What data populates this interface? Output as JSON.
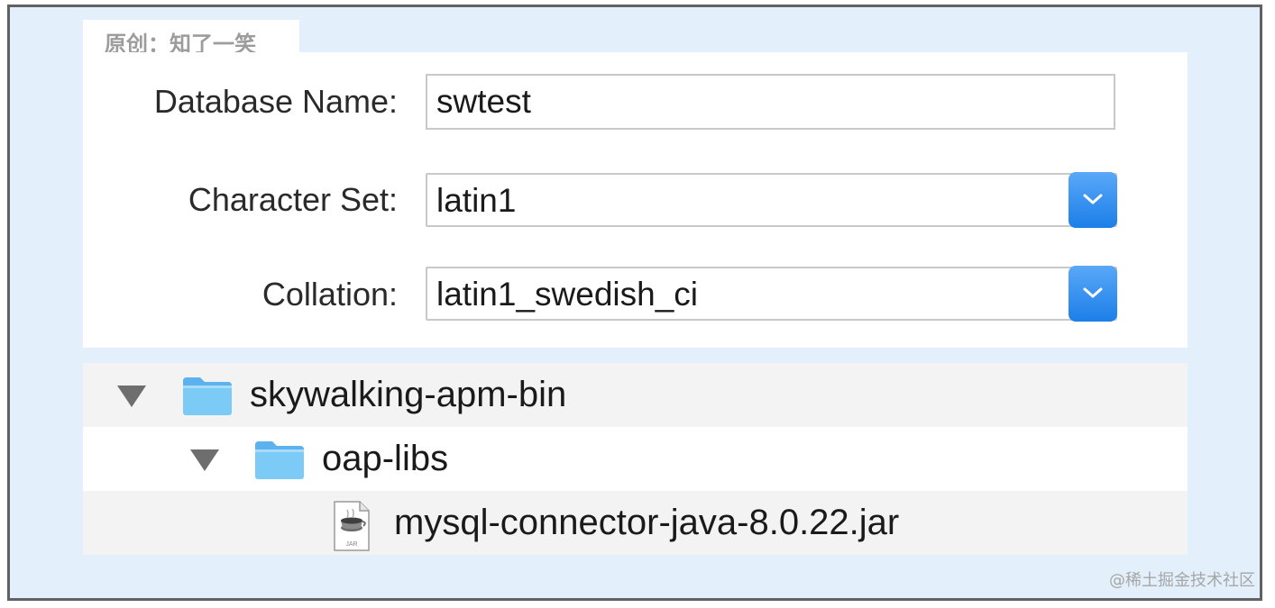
{
  "tab_label": "原创：知了一笑",
  "form": {
    "database_name_label": "Database Name:",
    "database_name_value": "swtest",
    "character_set_label": "Character Set:",
    "character_set_value": "latin1",
    "collation_label": "Collation:",
    "collation_value": "latin1_swedish_ci"
  },
  "tree": {
    "items": [
      {
        "label": "skywalking-apm-bin",
        "icon": "folder-icon",
        "expanded": true,
        "level": 0
      },
      {
        "label": "oap-libs",
        "icon": "folder-icon",
        "expanded": true,
        "level": 1
      },
      {
        "label": "mysql-connector-java-8.0.22.jar",
        "icon": "jar-file-icon",
        "jar_caption": "JAR",
        "level": 2
      }
    ]
  },
  "watermark": "@稀土掘金技术社区",
  "colors": {
    "accent": "#1c7fe8",
    "folder": "#6ec3f5",
    "row_alt": "#f3f3f3",
    "frame_bg": "#e3f0fb"
  }
}
